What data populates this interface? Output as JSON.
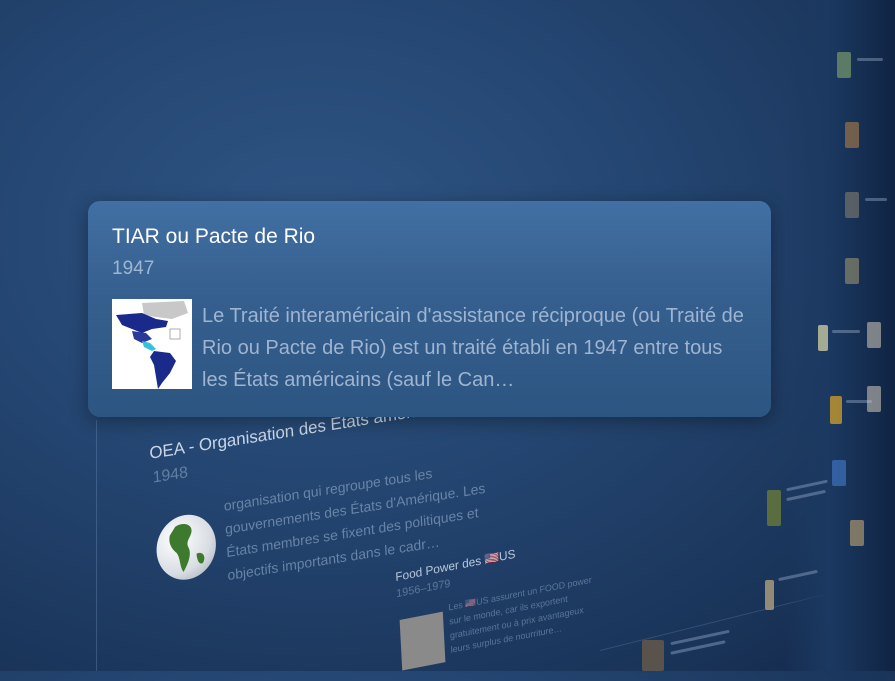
{
  "main_card": {
    "title": "TIAR ou Pacte de Rio",
    "year": "1947",
    "description": "Le Traité interaméricain d'assistance réciproque (ou Traité de Rio ou Pacte de Rio) est un traité établi en 1947 entre tous les États américains (sauf le Can…",
    "thumbnail_icon": "americas-map-icon"
  },
  "oea_card": {
    "title": "OEA - Organisation des États américains",
    "year": "1948",
    "description": "organisation qui regroupe tous les gouvernements des États d'Amérique. Les États membres se fixent des politiques et objectifs importants dans le cadr…",
    "thumbnail_icon": "globe-americas-icon"
  },
  "food_card": {
    "title": "Food Power des 🇺🇸US",
    "year": "1956–1979",
    "description": "Les 🇺🇸US assurent un FOOD power sur le monde, car ils exportent gratuitement ou à prix avantageux leurs surplus de nourriture…"
  },
  "colors": {
    "background": "#23446f",
    "card": "#3a6597",
    "title_text": "#ffffff",
    "muted_text": "#9fb4d1"
  }
}
